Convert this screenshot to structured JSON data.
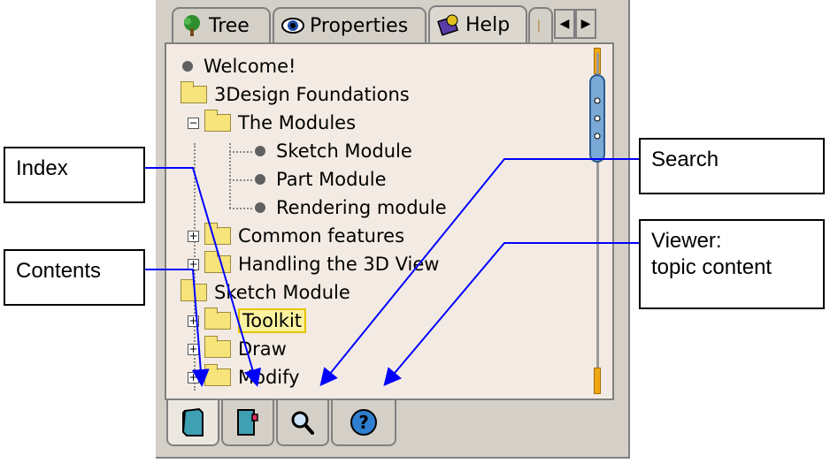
{
  "tabs": [
    {
      "label": "Tree",
      "icon": "tree-icon"
    },
    {
      "label": "Properties",
      "icon": "eye-icon"
    },
    {
      "label": "Help",
      "icon": "help-book-icon"
    }
  ],
  "tree": [
    {
      "label": "Welcome!",
      "kind": "topic"
    },
    {
      "label": "3Design Foundations",
      "kind": "folder"
    },
    {
      "label": "The Modules",
      "kind": "folder",
      "expander": "−"
    },
    {
      "label": "Sketch Module",
      "kind": "topic"
    },
    {
      "label": "Part Module",
      "kind": "topic"
    },
    {
      "label": "Rendering module",
      "kind": "topic"
    },
    {
      "label": "Common features",
      "kind": "folder",
      "expander": "+"
    },
    {
      "label": "Handling the 3D View",
      "kind": "folder",
      "expander": "+"
    },
    {
      "label": "Sketch Module",
      "kind": "folder"
    },
    {
      "label": "Toolkit",
      "kind": "folder",
      "expander": "+",
      "selected": true
    },
    {
      "label": "Draw",
      "kind": "folder",
      "expander": "+"
    },
    {
      "label": "Modify",
      "kind": "folder",
      "expander": "+"
    }
  ],
  "nav_tabs": [
    {
      "name": "contents",
      "icon": "book-icon"
    },
    {
      "name": "index",
      "icon": "index-book-icon"
    },
    {
      "name": "search",
      "icon": "magnifier-icon"
    },
    {
      "name": "viewer",
      "icon": "question-mark-icon"
    }
  ],
  "callouts": {
    "index": "Index",
    "contents": "Contents",
    "search": "Search",
    "viewer_line1": "Viewer:",
    "viewer_line2": "topic content"
  },
  "colors": {
    "panel": "#d4d0c8",
    "tree_bg": "#f3ebe3",
    "folder": "#f6e37a",
    "arrow": "#0000ff",
    "scroll_thumb": "#7ba9d6"
  }
}
